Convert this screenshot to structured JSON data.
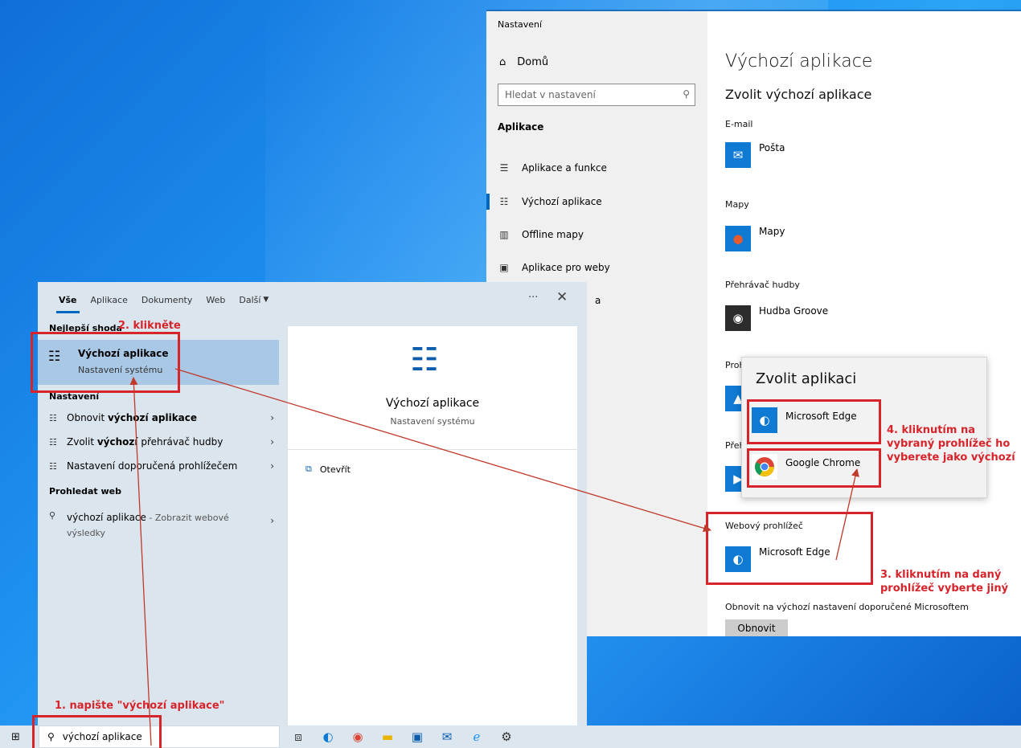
{
  "settings": {
    "app_title": "Nastavení",
    "nav_home": "Domů",
    "search_placeholder": "Hledat v nastavení",
    "section": "Aplikace",
    "nav_items": [
      {
        "label": "Aplikace a funkce",
        "icon": "apps-list-icon"
      },
      {
        "label": "Výchozí aplikace",
        "icon": "default-apps-icon"
      },
      {
        "label": "Offline mapy",
        "icon": "offline-maps-icon"
      },
      {
        "label": "Aplikace pro weby",
        "icon": "web-apps-icon"
      }
    ],
    "nav_partial": "a",
    "page_title": "Výchozí aplikace",
    "subtitle": "Zvolit výchozí aplikace",
    "email_label": "E-mail",
    "email_app": "Pošta",
    "maps_label": "Mapy",
    "maps_app": "Mapy",
    "music_label": "Přehrávač hudby",
    "music_app": "Hudba Groove",
    "photo_label_partial": "Proh",
    "video_label_partial": "Přeh",
    "browser_label": "Webový prohlížeč",
    "browser_app": "Microsoft Edge",
    "reset_label": "Obnovit na výchozí nastavení doporučené Microsoftem",
    "reset_button": "Obnovit"
  },
  "chooser": {
    "title": "Zvolit aplikaci",
    "options": [
      "Microsoft Edge",
      "Google Chrome"
    ]
  },
  "startmenu": {
    "tabs": [
      "Vše",
      "Aplikace",
      "Dokumenty",
      "Web",
      "Další"
    ],
    "dots": "···",
    "close": "✕",
    "best_match_header": "Nejlepší shoda",
    "best_title": "Výchozí aplikace",
    "best_sub": "Nastavení systému",
    "settings_header": "Nastavení",
    "setting_rows": [
      {
        "pre": "Obnovit ",
        "bold": "výchozí aplikace",
        "post": ""
      },
      {
        "pre": "Zvolit ",
        "bold": "výchozí",
        "post": " přehrávač hudby"
      },
      {
        "pre": "Nastavení doporučená prohlížečem",
        "bold": "",
        "post": ""
      }
    ],
    "web_header": "Prohledat web",
    "web_row_bold": "výchozí aplikace",
    "web_row_rest": " - Zobrazit webové",
    "web_row_line2": "výsledky",
    "preview_title": "Výchozí aplikace",
    "preview_sub": "Nastavení systému",
    "preview_open": "Otevřít"
  },
  "taskbar": {
    "search_value": "výchozí aplikace"
  },
  "annotations": {
    "step1": "1. napište \"výchozí aplikace\"",
    "step2": "2. klikněte",
    "step3_l1": "3. kliknutím na daný",
    "step3_l2": "prohlížeč vyberte jiný",
    "step4_l1": "4. kliknutím na",
    "step4_l2": "vybraný prohlížeč ho",
    "step4_l3": "vyberete jako výchozí",
    "color": "#d7232a"
  }
}
